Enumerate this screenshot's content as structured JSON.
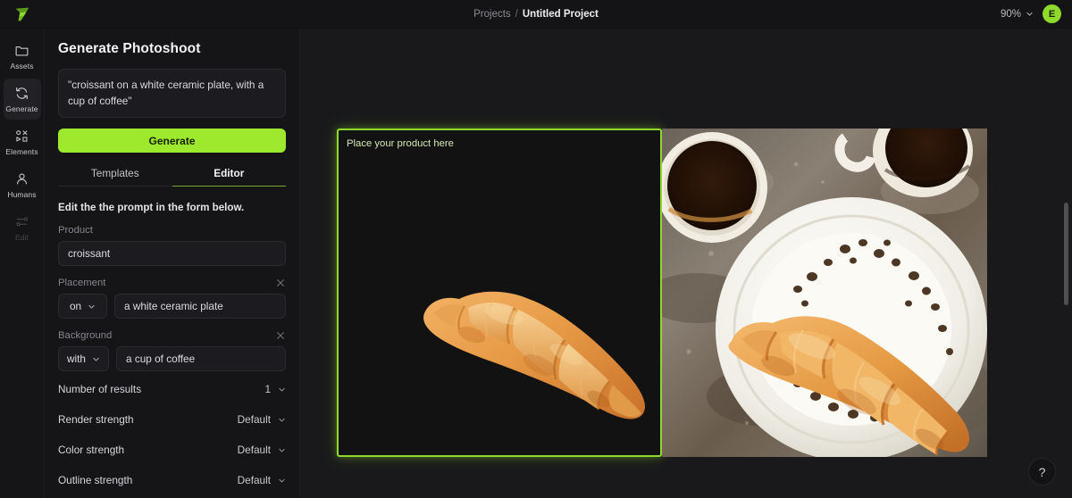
{
  "topbar": {
    "logo_icon": "flowing-f-logo-icon",
    "breadcrumb_parent": "Projects",
    "breadcrumb_separator": "/",
    "breadcrumb_current": "Untitled Project",
    "zoom_level": "90%",
    "zoom_chevron_icon": "chevron-down-icon",
    "avatar_initial": "E",
    "accent_color": "#8fd92c"
  },
  "rail": {
    "items": [
      {
        "label": "Assets",
        "icon": "folder-icon",
        "active": false,
        "disabled": false
      },
      {
        "label": "Generate",
        "icon": "refresh-icon",
        "active": true,
        "disabled": false
      },
      {
        "label": "Elements",
        "icon": "shapes-icon",
        "active": false,
        "disabled": false
      },
      {
        "label": "Humans",
        "icon": "person-icon",
        "active": false,
        "disabled": false
      },
      {
        "label": "Edit",
        "icon": "sliders-icon",
        "active": false,
        "disabled": true
      }
    ]
  },
  "panel": {
    "title": "Generate Photoshoot",
    "prompt_value": "\"croissant on a white ceramic plate, with a cup of coffee\"",
    "generate_label": "Generate",
    "tabs": [
      {
        "label": "Templates",
        "active": false
      },
      {
        "label": "Editor",
        "active": true
      }
    ],
    "hint": "Edit the the prompt in the form below.",
    "fields": [
      {
        "label": "Product",
        "has_clear": false,
        "clear_icon": "close-icon",
        "value": "croissant"
      },
      {
        "label": "Placement",
        "has_clear": true,
        "clear_icon": "close-icon",
        "preposition": "on",
        "preposition_chevron_icon": "chevron-down-icon",
        "value": "a white ceramic plate"
      },
      {
        "label": "Background",
        "has_clear": true,
        "clear_icon": "close-icon",
        "preposition": "with",
        "preposition_chevron_icon": "chevron-down-icon",
        "value": "a cup of coffee"
      }
    ],
    "options": [
      {
        "label": "Number of results",
        "value": "1",
        "chevron_icon": "chevron-down-icon"
      },
      {
        "label": "Render strength",
        "value": "Default",
        "chevron_icon": "chevron-down-icon"
      },
      {
        "label": "Color strength",
        "value": "Default",
        "chevron_icon": "chevron-down-icon"
      },
      {
        "label": "Outline strength",
        "value": "Default",
        "chevron_icon": "chevron-down-icon"
      }
    ]
  },
  "canvas": {
    "dropzone_label": "Place your product here",
    "dropzone_border_color": "#8fd92c",
    "product_image_alt": "croissant-cutout",
    "result_image_alt": "croissant-on-white-plate-with-coffee"
  },
  "help": {
    "label": "?",
    "icon": "question-mark-icon"
  }
}
